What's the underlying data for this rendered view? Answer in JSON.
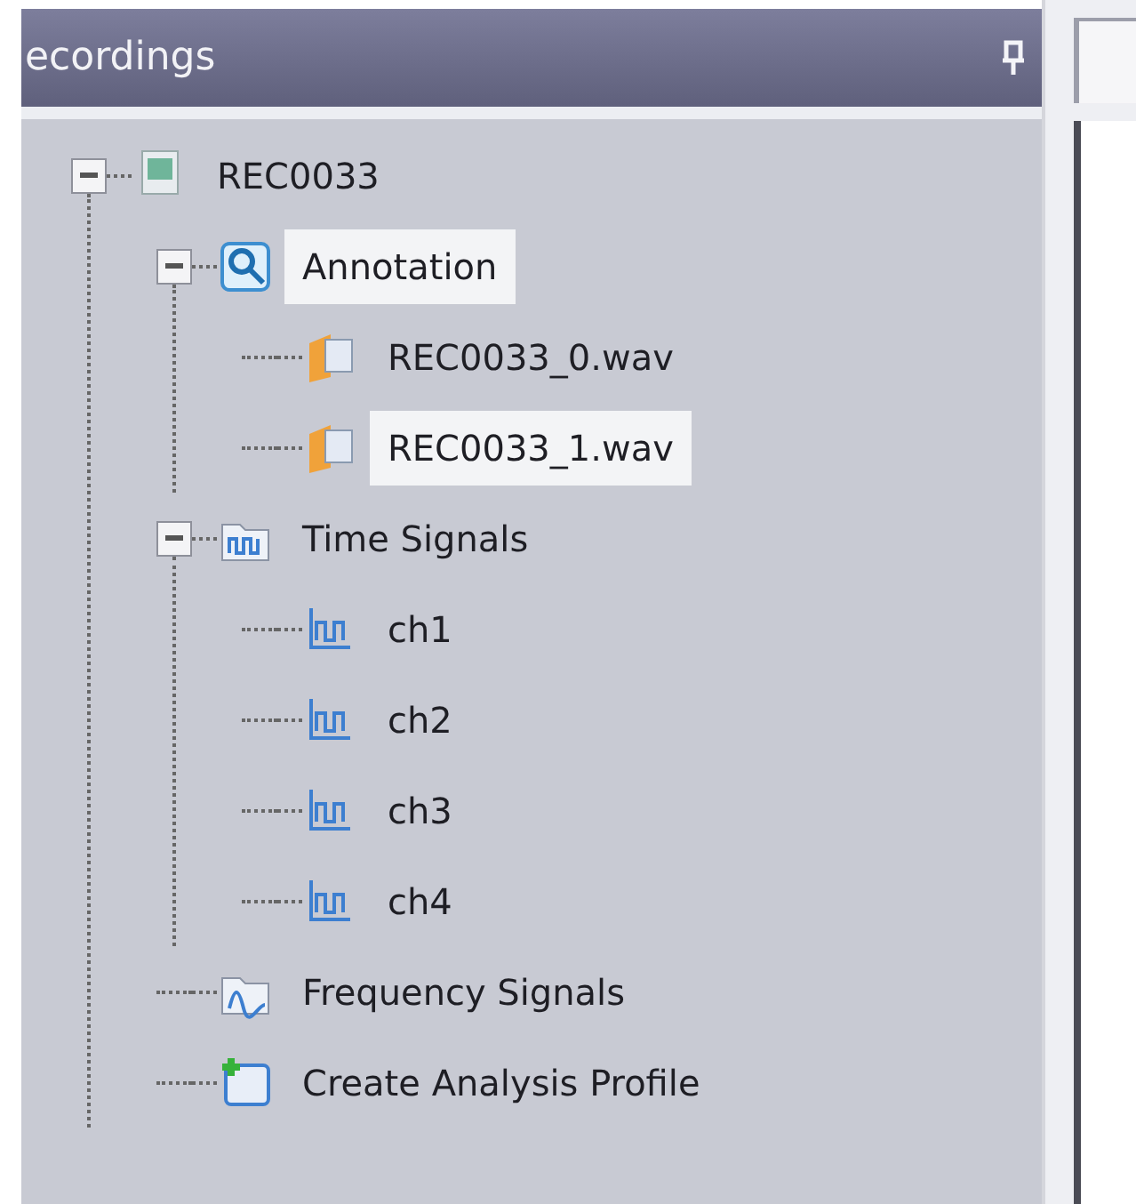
{
  "panel": {
    "title": "ecordings"
  },
  "tree": [
    {
      "label": "REC0033",
      "kind": "recording",
      "selected": false,
      "expanded": true,
      "children": [
        {
          "label": "Annotation",
          "kind": "annotation",
          "selected": true,
          "expanded": true,
          "children": [
            {
              "label": "REC0033_0.wav",
              "kind": "wav",
              "selected": false
            },
            {
              "label": "REC0033_1.wav",
              "kind": "wav",
              "selected": true
            }
          ]
        },
        {
          "label": "Time Signals",
          "kind": "time-folder",
          "selected": false,
          "expanded": true,
          "children": [
            {
              "label": "ch1",
              "kind": "signal",
              "selected": false
            },
            {
              "label": "ch2",
              "kind": "signal",
              "selected": false
            },
            {
              "label": "ch3",
              "kind": "signal",
              "selected": false
            },
            {
              "label": "ch4",
              "kind": "signal",
              "selected": false
            }
          ]
        },
        {
          "label": "Frequency Signals",
          "kind": "frequency-folder",
          "selected": false
        },
        {
          "label": "Create Analysis Profile",
          "kind": "create",
          "selected": false
        }
      ]
    }
  ]
}
